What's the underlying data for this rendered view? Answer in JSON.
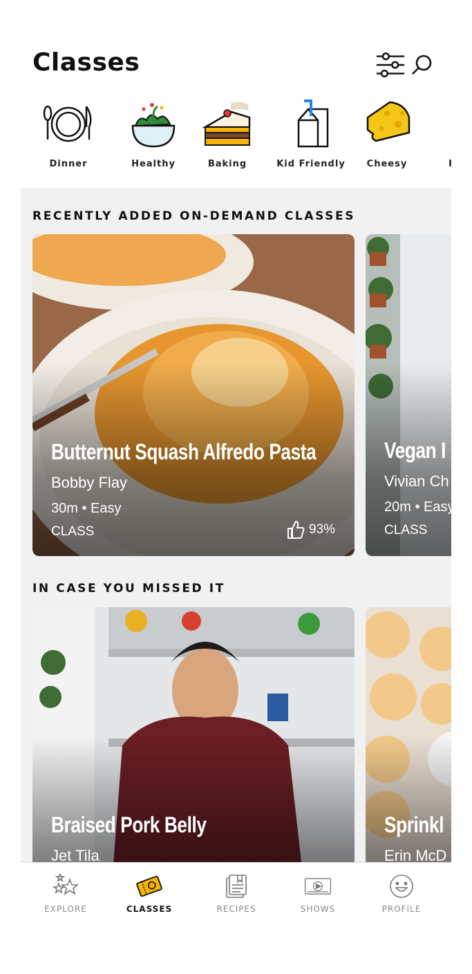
{
  "header": {
    "title": "Classes",
    "filter_icon": "sliders-icon",
    "search_icon": "search-icon"
  },
  "categories": [
    {
      "label": "Dinner",
      "icon": "plate-cutlery-icon"
    },
    {
      "label": "Healthy",
      "icon": "salad-bowl-icon"
    },
    {
      "label": "Baking",
      "icon": "cake-slice-icon"
    },
    {
      "label": "Kid Friendly",
      "icon": "milk-carton-icon"
    },
    {
      "label": "Cheesy",
      "icon": "cheese-icon"
    },
    {
      "label": "H",
      "icon": "partial-icon"
    }
  ],
  "sections": [
    {
      "title": "RECENTLY ADDED ON-DEMAND CLASSES",
      "cards": [
        {
          "title": "Butternut Squash Alfredo Pasta",
          "chef": "Bobby Flay",
          "duration": "30m",
          "difficulty": "Easy",
          "type": "CLASS",
          "rating": "93%"
        },
        {
          "title": "Vegan I",
          "chef": "Vivian Ch",
          "duration": "20m",
          "difficulty": "Easy",
          "type": "CLASS"
        }
      ]
    },
    {
      "title": "IN CASE YOU MISSED IT",
      "cards": [
        {
          "title": "Braised Pork Belly",
          "chef": "Jet Tila"
        },
        {
          "title": "Sprinkl",
          "chef": "Erin McD"
        }
      ]
    }
  ],
  "tabs": [
    {
      "label": "EXPLORE",
      "icon": "stars-icon",
      "active": false
    },
    {
      "label": "CLASSES",
      "icon": "class-ticket-icon",
      "active": true
    },
    {
      "label": "RECIPES",
      "icon": "recipe-book-icon",
      "active": false
    },
    {
      "label": "SHOWS",
      "icon": "play-screen-icon",
      "active": false
    },
    {
      "label": "PROFILE",
      "icon": "smiley-face-icon",
      "active": false
    }
  ],
  "colors": {
    "accent": "#f5b400",
    "background": "#f1f1f1",
    "text": "#111111",
    "inactive": "#888888"
  }
}
